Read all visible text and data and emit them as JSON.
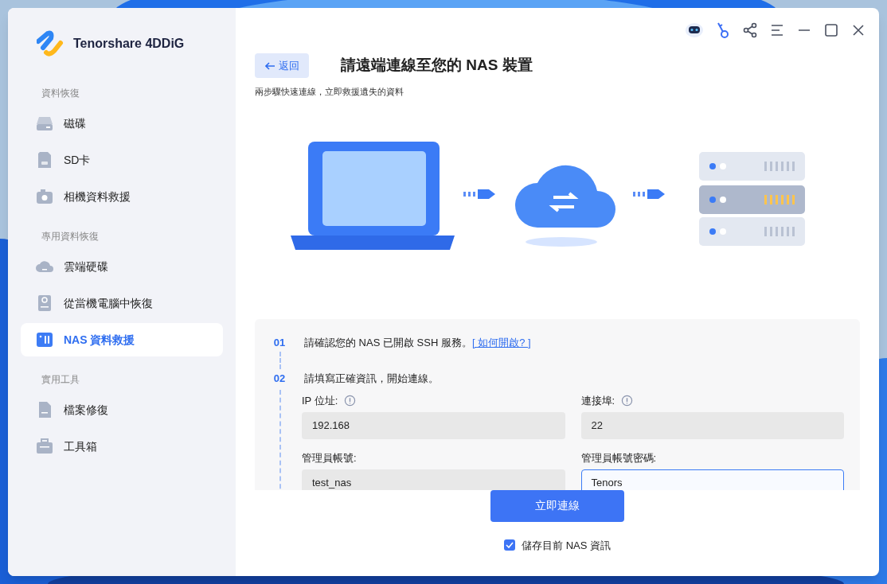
{
  "app": {
    "name": "Tenorshare 4DDiG"
  },
  "sidebar": {
    "sections": [
      {
        "title": "資料恢復",
        "items": [
          {
            "label": "磁碟",
            "kind": "disk",
            "selected": false
          },
          {
            "label": "SD卡",
            "kind": "sd",
            "selected": false
          },
          {
            "label": "相機資料救援",
            "kind": "camera",
            "selected": false
          }
        ]
      },
      {
        "title": "專用資料恢復",
        "items": [
          {
            "label": "雲端硬碟",
            "kind": "cloud",
            "selected": false
          },
          {
            "label": "從當機電腦中恢復",
            "kind": "computer",
            "selected": false
          },
          {
            "label": "NAS 資料救援",
            "kind": "nas",
            "selected": true
          }
        ]
      },
      {
        "title": "實用工具",
        "items": [
          {
            "label": "檔案修復",
            "kind": "file",
            "selected": false
          },
          {
            "label": "工具箱",
            "kind": "toolbox",
            "selected": false
          }
        ]
      }
    ]
  },
  "back_button": "返回",
  "title": "請遠端連線至您的 NAS 裝置",
  "subtitle": "兩步驟快速連線，立即救援遺失的資料",
  "steps": [
    {
      "number": "01",
      "text": "請確認您的 NAS 已開啟 SSH 服務。",
      "link": "[ 如何開啟? ]"
    },
    {
      "number": "02",
      "text": "請填寫正確資訊，開始連線。"
    }
  ],
  "fields": [
    {
      "label": "IP 位址:",
      "value": "192.168",
      "info": true,
      "focused": false
    },
    {
      "label": "連接埠:",
      "value": "22",
      "info": true,
      "focused": false
    },
    {
      "label": "管理員帳號:",
      "value": "test_nas",
      "info": false,
      "focused": false
    },
    {
      "label": "管理員帳號密碼:",
      "value": "Tenors",
      "info": false,
      "focused": true
    }
  ],
  "connect_button": "立即連線",
  "save_checkbox": {
    "label": "儲存目前 NAS 資訊",
    "checked": true
  }
}
